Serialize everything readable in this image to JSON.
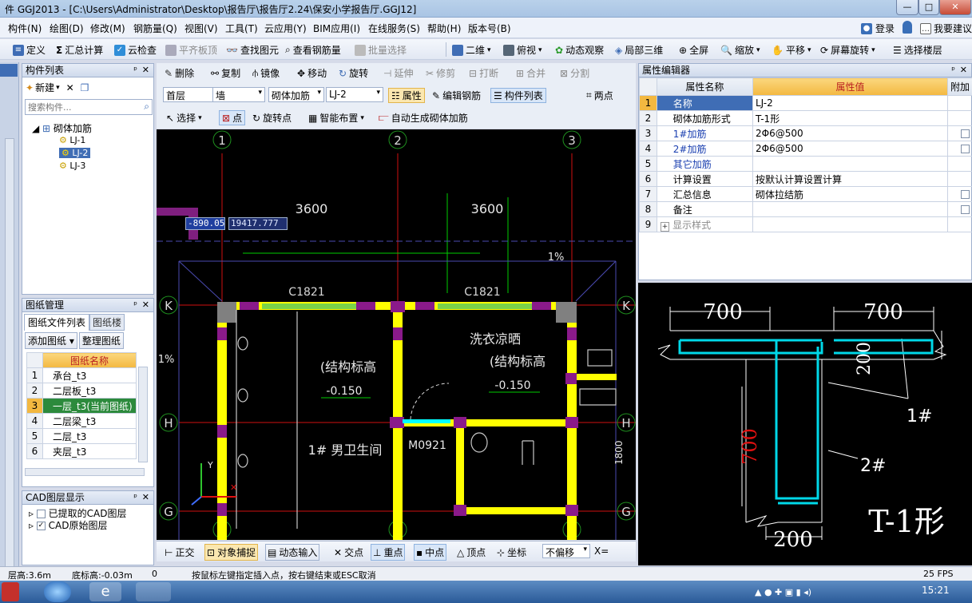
{
  "window": {
    "title": "件 GGJ2013 - [C:\\Users\\Administrator\\Desktop\\报告厅\\报告厅2.24\\保安小学报告厅.GGJ12]",
    "min": "—",
    "max": "□",
    "close": "✕"
  },
  "menu": [
    "构件(N)",
    "绘图(D)",
    "修改(M)",
    "钢筋量(Q)",
    "视图(V)",
    "工具(T)",
    "云应用(Y)",
    "BIM应用(I)",
    "在线服务(S)",
    "帮助(H)",
    "版本号(B)"
  ],
  "menu_right": {
    "login": "登录",
    "suggest": "我要建议"
  },
  "toolbar1": [
    "定义",
    "汇总计算",
    "云检查",
    "平齐板顶",
    "查找图元",
    "查看钢筋量",
    "批量选择",
    "二维",
    "俯视",
    "动态观察",
    "局部三维",
    "全屏",
    "缩放",
    "平移",
    "屏幕旋转",
    "选择楼层"
  ],
  "toolbar2": [
    "删除",
    "复制",
    "镜像",
    "移动",
    "旋转",
    "延伸",
    "修剪",
    "打断",
    "合并",
    "分割"
  ],
  "toolbar3": {
    "floor": "首层",
    "type": "墙",
    "sub": "砌体加筋",
    "item": "LJ-2",
    "attr": "属性",
    "edit": "编辑钢筋",
    "list": "构件列表",
    "two": "两点"
  },
  "toolbar4": [
    "选择",
    "点",
    "旋转点",
    "智能布置",
    "自动生成砌体加筋"
  ],
  "component_list": {
    "title": "构件列表",
    "new": "新建",
    "search_placeholder": "搜索构件...",
    "root": "砌体加筋",
    "items": [
      "LJ-1",
      "LJ-2",
      "LJ-3"
    ]
  },
  "drawing_manager": {
    "title": "图纸管理",
    "tab1": "图纸文件列表",
    "tab2": "图纸楼",
    "add": "添加图纸",
    "organize": "整理图纸",
    "col": "图纸名称",
    "rows": [
      {
        "n": "1",
        "name": "承台_t3"
      },
      {
        "n": "2",
        "name": "二层板_t3"
      },
      {
        "n": "3",
        "name": "一层_t3(当前图纸)"
      },
      {
        "n": "4",
        "name": "二层梁_t3"
      },
      {
        "n": "5",
        "name": "二层_t3"
      },
      {
        "n": "6",
        "name": "夹层_t3"
      }
    ]
  },
  "cad_layers": {
    "title": "CAD图层显示",
    "l1": "已提取的CAD图层",
    "l2": "CAD原始图层"
  },
  "property_editor": {
    "title": "属性编辑器",
    "col_name": "属性名称",
    "col_value": "属性值",
    "col_extra": "附加",
    "rows": [
      {
        "n": "1",
        "name": "名称",
        "value": "LJ-2",
        "blue": true,
        "chk": false
      },
      {
        "n": "2",
        "name": "砌体加筋形式",
        "value": "T-1形",
        "blue": false,
        "chk": false
      },
      {
        "n": "3",
        "name": "1#加筋",
        "value": "2Φ6@500",
        "blue": true,
        "chk": true
      },
      {
        "n": "4",
        "name": "2#加筋",
        "value": "2Φ6@500",
        "blue": true,
        "chk": true
      },
      {
        "n": "5",
        "name": "其它加筋",
        "value": "",
        "blue": true,
        "chk": false
      },
      {
        "n": "6",
        "name": "计算设置",
        "value": "按默认计算设置计算",
        "blue": false,
        "chk": false
      },
      {
        "n": "7",
        "name": "汇总信息",
        "value": "砌体拉结筋",
        "blue": false,
        "chk": true
      },
      {
        "n": "8",
        "name": "备注",
        "value": "",
        "blue": false,
        "chk": true
      },
      {
        "n": "9",
        "name": "显示样式",
        "value": "",
        "blue": false,
        "chk": false
      }
    ]
  },
  "cad": {
    "axes_top": [
      "1",
      "2",
      "3"
    ],
    "axes_side": [
      "K",
      "H",
      "G"
    ],
    "dims": [
      "3600",
      "3600"
    ],
    "slope": "1%",
    "slope2": "1%",
    "coord_x": "-890.05",
    "coord_y": "19417.777",
    "windows": [
      "C1821",
      "C1821"
    ],
    "door": "M0921",
    "room1": "洗衣凉晒",
    "struct1": "(结构标高",
    "struct2": "(结构标高",
    "elev1": "-0.150",
    "elev2": "-0.150",
    "room2": "1# 男卫生间",
    "dim_side": "1800"
  },
  "preview": {
    "d1": "700",
    "d2": "700",
    "d3": "200",
    "d4": "700",
    "d5": "200",
    "bar1": "1#",
    "bar2": "2#",
    "shape": "T-1形"
  },
  "snapbar": [
    "正交",
    "对象捕捉",
    "动态输入",
    "交点",
    "重点",
    "中点",
    "顶点",
    "坐标",
    "不偏移",
    "X="
  ],
  "status": {
    "floor_h": "层高:3.6m",
    "base_h": "底标高:-0.03m",
    "zero": "0",
    "hint": "按鼠标左键指定插入点，按右键结束或ESC取消",
    "fps": "25 FPS"
  },
  "taskbar": {
    "time": "15:21"
  },
  "colors": {
    "wall": "#ffff00",
    "col": "#7f1f7f",
    "bar": "#00ffff",
    "axis": "#ff0000",
    "grid": "#00cc00"
  }
}
